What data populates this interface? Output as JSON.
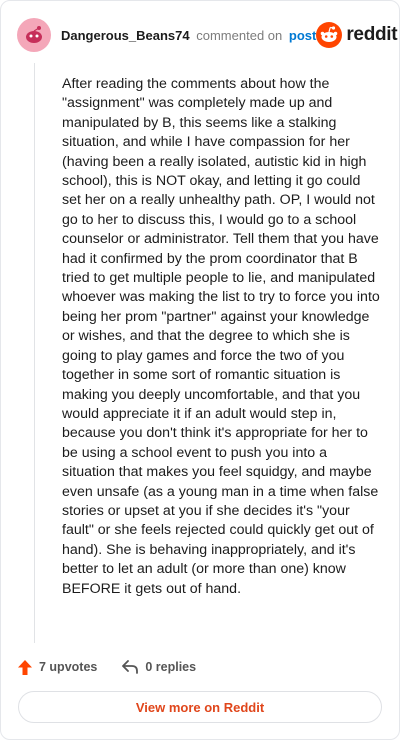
{
  "header": {
    "username": "Dangerous_Beans74",
    "commented_on": "commented on",
    "post_link": "post",
    "brand": "reddit"
  },
  "comment": {
    "body": "After reading the comments about how the \"assignment\" was completely made up and manipulated by B, this seems like a stalking situation, and while I have compassion for her (having been a really isolated, autistic kid in high school), this is NOT okay, and letting it go could set her on a really unhealthy path. OP, I would not go to her to discuss this, I would go to a school counselor or administrator. Tell them that you have had it confirmed by the prom coordinator that B tried to get multiple people to lie, and manipulated whoever was making the list to try to force you into being her prom \"partner\" against your knowledge or wishes, and that the degree to which she is going to play games and force the two of you together in some sort of romantic situation is making you deeply uncomfortable, and that you would appreciate it if an adult would step in, because you don't think it's appropriate for her to be using a school event to push you into a situation that makes you feel squidgy, and maybe even unsafe (as a young man in a time when false stories or upset at you if she decides it's \"your fault\" or she feels rejected could quickly get out of hand). She is behaving inappropriately, and it's better to let an adult (or more than one) know BEFORE it gets out of hand."
  },
  "actions": {
    "upvotes": "7 upvotes",
    "replies": "0 replies"
  },
  "footer": {
    "view_more": "View more on Reddit"
  },
  "colors": {
    "upvote": "#ff4500",
    "brand": "#ff4500",
    "link": "#0079d3",
    "view_more": "#e0461b",
    "avatar": "#f4a7b9"
  },
  "icons": {
    "avatar": "snoo-avatar-icon",
    "brand": "reddit-logo-icon",
    "upvote": "upvote-arrow-icon",
    "reply": "reply-arrow-icon"
  }
}
